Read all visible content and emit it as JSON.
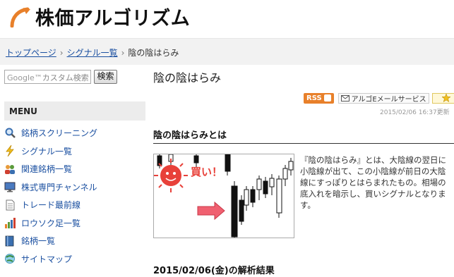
{
  "site": {
    "title": "株価アルゴリズム"
  },
  "breadcrumb": {
    "items": [
      "トップページ",
      "シグナル一覧"
    ],
    "separator": "›",
    "current": "陰の陰はらみ"
  },
  "search": {
    "placeholder_prefix": "Google™",
    "placeholder": "カスタム検索",
    "button_label": "検索"
  },
  "sidebar": {
    "menu_title": "MENU",
    "items": [
      {
        "label": "銘柄スクリーニング",
        "icon": "magnifier-icon"
      },
      {
        "label": "シグナル一覧",
        "icon": "lightning-icon"
      },
      {
        "label": "関連銘柄一覧",
        "icon": "people-icon"
      },
      {
        "label": "株式専門チャンネル",
        "icon": "monitor-icon"
      },
      {
        "label": "トレード最前線",
        "icon": "document-icon"
      },
      {
        "label": "ロウソク足一覧",
        "icon": "bar-chart-icon"
      },
      {
        "label": "銘柄一覧",
        "icon": "book-icon"
      },
      {
        "label": "サイトマップ",
        "icon": "sitemap-icon"
      }
    ]
  },
  "main": {
    "title": "陰の陰はらみ",
    "share": {
      "rss_label": "RSS",
      "mail_label": "アルゴEメールサービス"
    },
    "date_stamp": "2015/02/06 16:37更新",
    "section_title": "陰の陰はらみとは",
    "chart_caption": "買い！",
    "description_lines": [
      "『陰の陰はらみ』とは、大陰線の翌日に",
      "小陰線が出て、この小陰線が前日の大陰",
      "線にすっぽりとはらまれたもの。相場の",
      "底入れを暗示し、買いシグナルとなりま",
      "す。"
    ],
    "result_title": "2015/02/06(金)の解析結果"
  },
  "colors": {
    "accent_orange": "#e8802a",
    "link_blue": "#1a4fa0",
    "sun_red": "#e8413a",
    "arrow_pink": "#f06070"
  }
}
